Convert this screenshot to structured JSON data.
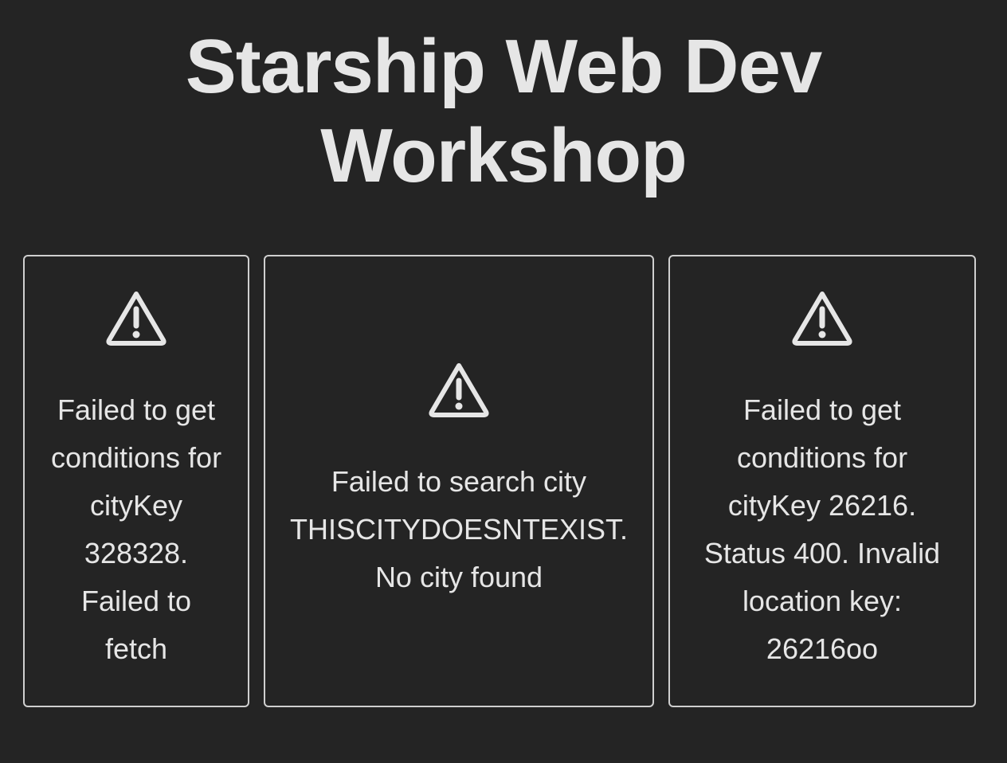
{
  "header": {
    "title": "Starship Web Dev Workshop"
  },
  "cards": [
    {
      "icon": "warning-icon",
      "message": "Failed to get conditions for cityKey 328328. Failed to fetch"
    },
    {
      "icon": "warning-icon",
      "message": "Failed to search city THISCITYDOESNTEXIST. No city found"
    },
    {
      "icon": "warning-icon",
      "message": "Failed to get conditions for cityKey 26216. Status 400. Invalid location key: 26216oo"
    }
  ],
  "colors": {
    "background": "#242424",
    "text": "#e6e6e6",
    "border": "#cfcfcf"
  }
}
